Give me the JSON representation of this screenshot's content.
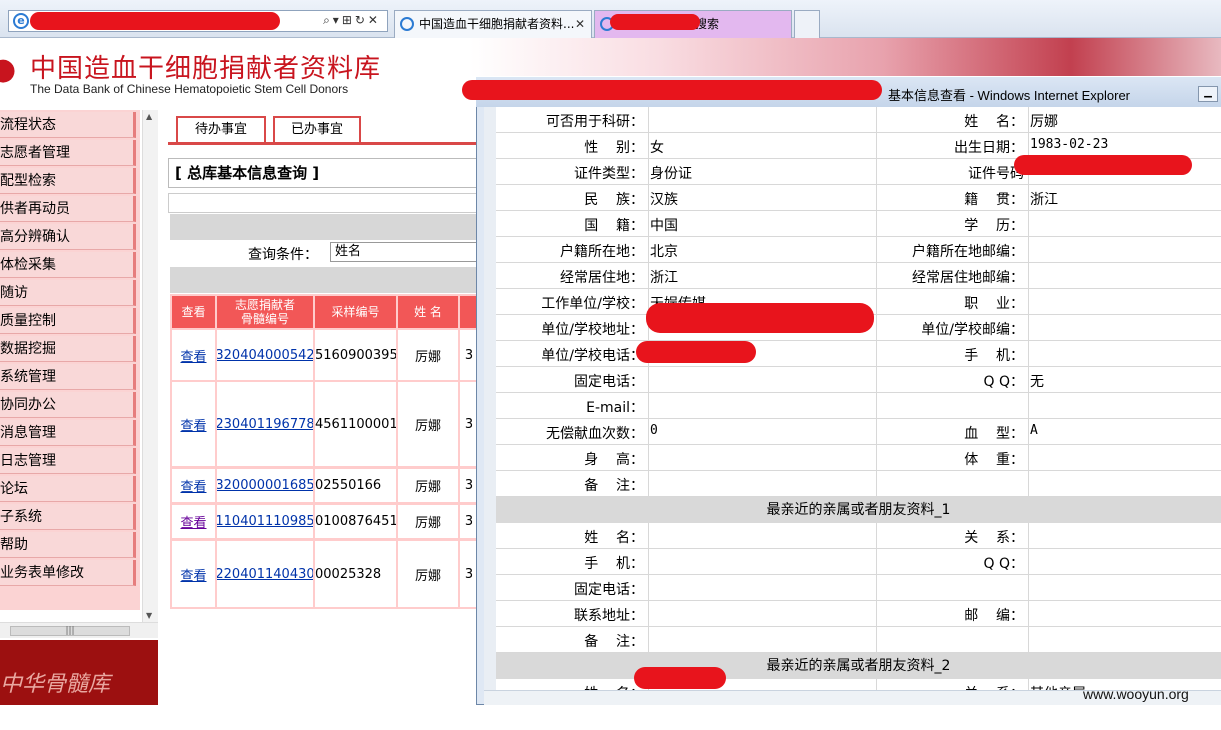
{
  "browser": {
    "tab1_title": "中国造血干细胞捐献者资料...",
    "tab2_title": "搜索",
    "tab_close": "✕",
    "address_tools": "⌕▾⊞↻✕"
  },
  "site": {
    "title": "中国造血干细胞捐献者资料库",
    "subtitle": "The Data Bank of Chinese Hematopoietic Stem Cell Donors",
    "footer_logo": "中华骨髓库"
  },
  "nav": {
    "items": [
      "流程状态",
      "志愿者管理",
      "配型检索",
      "供者再动员",
      "高分辨确认",
      "体检采集",
      "随访",
      "质量控制",
      "数据挖掘",
      "系统管理",
      "协同办公",
      "消息管理",
      "日志管理",
      "论坛",
      "子系统",
      "帮助",
      "业务表单修改"
    ]
  },
  "main": {
    "tabs": [
      "待办事宜",
      "已办事宜"
    ],
    "panel_title": "[ 总库基本信息查询 ]",
    "query_label": "查询条件：",
    "query_value": "姓名",
    "columns": [
      "查看",
      "志愿捐献者\n骨髓编号",
      "采样编号",
      "姓 名"
    ],
    "rows": [
      {
        "view": "查看",
        "id": "320404000542",
        "sample": "5160900395",
        "name": "厉娜",
        "extra": "3"
      },
      {
        "view": "查看",
        "id": "230401196778",
        "sample": "4561100001",
        "name": "厉娜",
        "extra": "3"
      },
      {
        "view": "查看",
        "id": "320000001685",
        "sample": "02550166",
        "name": "厉娜",
        "extra": "3"
      },
      {
        "view": "查看",
        "id": "110401110985",
        "sample": "0100876451",
        "name": "厉娜",
        "extra": "3"
      },
      {
        "view": "查看",
        "id": "220401140430",
        "sample": "00025328",
        "name": "厉娜",
        "extra": "3"
      }
    ]
  },
  "popup": {
    "title": "基本信息查看 - Windows Internet Explorer",
    "fields_left": [
      {
        "label": "可否用于科研：",
        "value": ""
      },
      {
        "label": "性    别：",
        "value": "女"
      },
      {
        "label": "证件类型：",
        "value": "身份证"
      },
      {
        "label": "民    族：",
        "value": "汉族"
      },
      {
        "label": "国    籍：",
        "value": "中国"
      },
      {
        "label": "户籍所在地：",
        "value": "北京"
      },
      {
        "label": "经常居住地：",
        "value": "浙江"
      },
      {
        "label": "工作单位/学校：",
        "value": "天娱传媒"
      },
      {
        "label": "单位/学校地址：",
        "value": ""
      },
      {
        "label": "单位/学校电话：",
        "value": ""
      },
      {
        "label": "固定电话：",
        "value": ""
      },
      {
        "label": "E-mail：",
        "value": ""
      },
      {
        "label": "无偿献血次数：",
        "value": "0"
      },
      {
        "label": "身    高：",
        "value": ""
      },
      {
        "label": "备    注：",
        "value": ""
      }
    ],
    "fields_right": [
      {
        "label": "姓    名：",
        "value": "厉娜"
      },
      {
        "label": "出生日期：",
        "value": "1983-02-23"
      },
      {
        "label": "证件号码",
        "value": ""
      },
      {
        "label": "籍    贯：",
        "value": "浙江"
      },
      {
        "label": "学    历：",
        "value": ""
      },
      {
        "label": "户籍所在地邮编：",
        "value": ""
      },
      {
        "label": "经常居住地邮编：",
        "value": ""
      },
      {
        "label": "职    业：",
        "value": ""
      },
      {
        "label": "单位/学校邮编：",
        "value": ""
      },
      {
        "label": "手    机：",
        "value": ""
      },
      {
        "label": "Q Q：",
        "value": "无"
      },
      {
        "label": "",
        "value": ""
      },
      {
        "label": "血    型：",
        "value": "A"
      },
      {
        "label": "体    重：",
        "value": ""
      },
      {
        "label": "",
        "value": ""
      }
    ],
    "section1": "最亲近的亲属或者朋友资料_1",
    "s1_left": [
      {
        "label": "姓    名：",
        "value": ""
      },
      {
        "label": "手    机：",
        "value": ""
      },
      {
        "label": "固定电话：",
        "value": ""
      },
      {
        "label": "联系地址：",
        "value": ""
      },
      {
        "label": "备    注：",
        "value": ""
      }
    ],
    "s1_right": [
      {
        "label": "关    系：",
        "value": ""
      },
      {
        "label": "Q Q：",
        "value": ""
      },
      {
        "label": "",
        "value": ""
      },
      {
        "label": "邮    编：",
        "value": ""
      },
      {
        "label": "",
        "value": ""
      }
    ],
    "section2": "最亲近的亲属或者朋友资料_2",
    "s2_left": [
      {
        "label": "姓    名：",
        "value": ""
      }
    ],
    "s2_right": [
      {
        "label": "关    系：",
        "value": "其他亲属"
      }
    ]
  },
  "watermark": "www.wooyun.org",
  "colors": {
    "accent_red": "#e8141c",
    "nav_bg": "#f9d8d8",
    "grid_header": "#f25757",
    "section_bg": "#d9d9d9"
  }
}
